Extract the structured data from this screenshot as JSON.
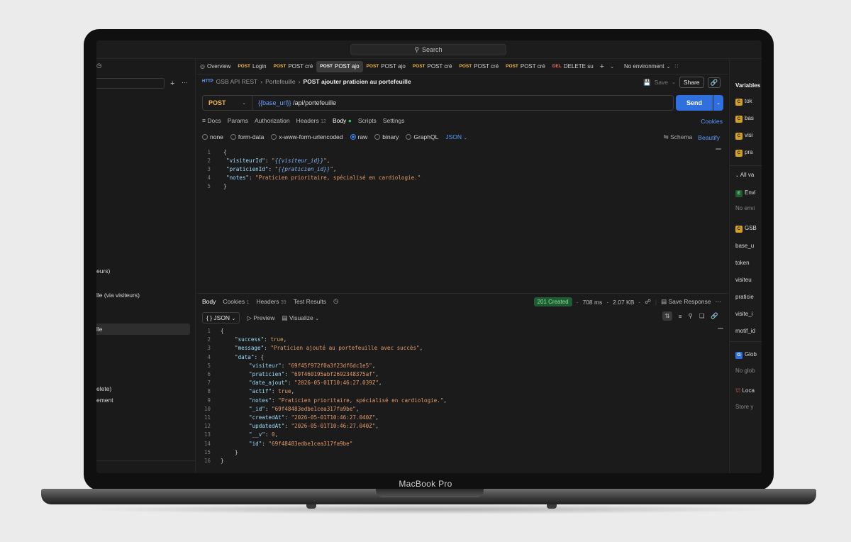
{
  "device": {
    "brand": "MacBook Pro"
  },
  "titlebar": {
    "search_label": "Search"
  },
  "sidebar": {
    "items": [
      "eurs)",
      "lle (via visiteurs)",
      "lle",
      "elete)",
      "ement"
    ]
  },
  "tabs": [
    {
      "method": "",
      "label": "Overview"
    },
    {
      "method": "POST",
      "label": "Login"
    },
    {
      "method": "POST",
      "label": "POST cré"
    },
    {
      "method": "POST",
      "label": "POST ajo",
      "active": true
    },
    {
      "method": "POST",
      "label": "POST ajo"
    },
    {
      "method": "POST",
      "label": "POST cré"
    },
    {
      "method": "POST",
      "label": "POST cré"
    },
    {
      "method": "POST",
      "label": "POST cré"
    },
    {
      "method": "DEL",
      "label": "DELETE su"
    }
  ],
  "environment": {
    "label": "No environment"
  },
  "breadcrumb": {
    "collection": "GSB API REST",
    "folder": "Portefeuille",
    "request": "POST ajouter praticien au portefeuille"
  },
  "actions": {
    "save": "Save",
    "share": "Share",
    "send": "Send",
    "cookies": "Cookies"
  },
  "request": {
    "method": "POST",
    "url_var": "{{base_url}}",
    "url_path": "/api/portefeuille",
    "tabs": {
      "docs": "Docs",
      "params": "Params",
      "auth": "Authorization",
      "headers": "Headers",
      "headers_count": "12",
      "body": "Body",
      "scripts": "Scripts",
      "settings": "Settings"
    },
    "body_options": {
      "none": "none",
      "form_data": "form-data",
      "urlencoded": "x-www-form-urlencoded",
      "raw": "raw",
      "binary": "binary",
      "graphql": "GraphQL",
      "format": "JSON",
      "schema": "Schema",
      "beautify": "Beautify"
    }
  },
  "response": {
    "tabs": {
      "body": "Body",
      "cookies": "Cookies",
      "cookies_count": "1",
      "headers": "Headers",
      "headers_count": "39",
      "test_results": "Test Results"
    },
    "status": "201 Created",
    "time": "708 ms",
    "size": "2.07 KB",
    "save_response": "Save Response",
    "format": "JSON",
    "preview": "Preview",
    "visualize": "Visualize"
  },
  "right_panel": {
    "title": "Variables",
    "vars_top": [
      "tok",
      "bas",
      "visi",
      "pra"
    ],
    "all_vars": "All va",
    "env_section": "Envi",
    "no_env": "No envi",
    "gsb_section": "GSB",
    "gsb_vars": [
      "base_u",
      "token",
      "visiteu",
      "praticie",
      "visite_i",
      "motif_id"
    ],
    "globals": "Glob",
    "no_globals": "No glob",
    "local": "Loca",
    "store": "Store y"
  }
}
